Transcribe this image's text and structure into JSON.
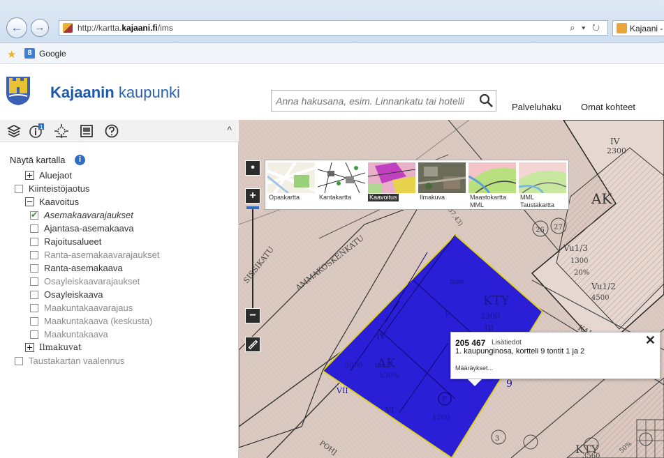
{
  "browser": {
    "back_icon": "back-arrow-icon",
    "forward_icon": "forward-arrow-icon",
    "url_prefix": "http://kartta.",
    "url_domain": "kajaani.fi",
    "url_path": "/ims",
    "url_tools": "⌕ ▾ ↻",
    "tab_label": "Kajaani -",
    "favorite": "Google"
  },
  "header": {
    "brand_bold": "Kajaanin",
    "brand_rest": " kaupunki",
    "search_placeholder": "Anna hakusana, esim. Linnankatu tai hotelli",
    "links": [
      "Palveluhaku",
      "Omat kohteet"
    ]
  },
  "panel": {
    "tabs": [
      "layers-icon",
      "info-icon",
      "locate-icon",
      "map-print-icon",
      "help-icon"
    ],
    "collapse": "^",
    "title": "Näytä kartalla",
    "info_badge": "i",
    "items": [
      {
        "label": "Aluejaot",
        "kind": "plus"
      },
      {
        "label": "Kiinteistöjaotus",
        "kind": "box"
      },
      {
        "label": "Kaavoitus",
        "kind": "minus"
      },
      {
        "label": "Asemakaavarajaukset",
        "kind": "checked"
      },
      {
        "label": "Ajantasa-asemakaava",
        "kind": "box"
      },
      {
        "label": "Rajoitusalueet",
        "kind": "box"
      },
      {
        "label": "Ranta-asemakaavarajaukset",
        "kind": "box"
      },
      {
        "label": "Ranta-asemakaava",
        "kind": "box"
      },
      {
        "label": "Osayleiskaavarajaukset",
        "kind": "box"
      },
      {
        "label": "Osayleiskaava",
        "kind": "box"
      },
      {
        "label": "Maakuntakaavarajaus",
        "kind": "box"
      },
      {
        "label": "Maakuntakaava (keskusta)",
        "kind": "box"
      },
      {
        "label": "Maakuntakaava",
        "kind": "box"
      },
      {
        "label": "Ilmakuvat",
        "kind": "plus"
      },
      {
        "label": "Taustakartan vaalennus",
        "kind": "box"
      }
    ]
  },
  "map": {
    "zoom_in": "+",
    "zoom_out": "−",
    "locate": "•",
    "ruler_icon": "ruler-icon",
    "layers": [
      {
        "label": "Opaskartta",
        "label2": ""
      },
      {
        "label": "Kantakartta",
        "label2": ""
      },
      {
        "label": "Kaavoitus",
        "label2": ""
      },
      {
        "label": "Ilmakuva",
        "label2": ""
      },
      {
        "label": "Maastokartta",
        "label2": "MML"
      },
      {
        "label": "MML",
        "label2": "Taustakartta"
      }
    ],
    "popup": {
      "id": "205 467",
      "link": "Lisätiedot",
      "desc": "1. kaupunginosa, kortteli 9 tontit 1 ja 2",
      "more": "Määräykset...",
      "close": "✕"
    },
    "labels": {
      "street1": "AMMAKOSKENKATU",
      "street2": "SISSIKATU",
      "street3": "KAU",
      "street4": "POHJ",
      "kty1": "KTY",
      "kty2": "KTY",
      "ak1": "AK",
      "ak2": "AK",
      "ak_pct": "k30%",
      "n2300a": "2300",
      "n2300b": "2300",
      "n5000": "5000",
      "ma7": "ma-7",
      "n1200": "1200",
      "n1300": "1300",
      "vu13": "Vu1/3",
      "vu12": "Vu1/2",
      "n4500": "4500",
      "r_iv": "IV",
      "r_iv2": "IV",
      "r_vii": "VII",
      "r_vi": "VI",
      "r_iii": "III",
      "n9": "9",
      "n26": "26",
      "n27": "27",
      "n3": "3",
      "n137": "(+137,43)",
      "p": "P",
      "mav": "mav",
      "p_small": "p",
      "pct20": "20%",
      "n3560": "3560",
      "n50": "50%"
    }
  },
  "colors": {
    "plan_block": "#2a1fd6",
    "plan_edge": "#e0d21b",
    "brand": "#1d57a8",
    "map_bg": "#d9c8c0"
  }
}
